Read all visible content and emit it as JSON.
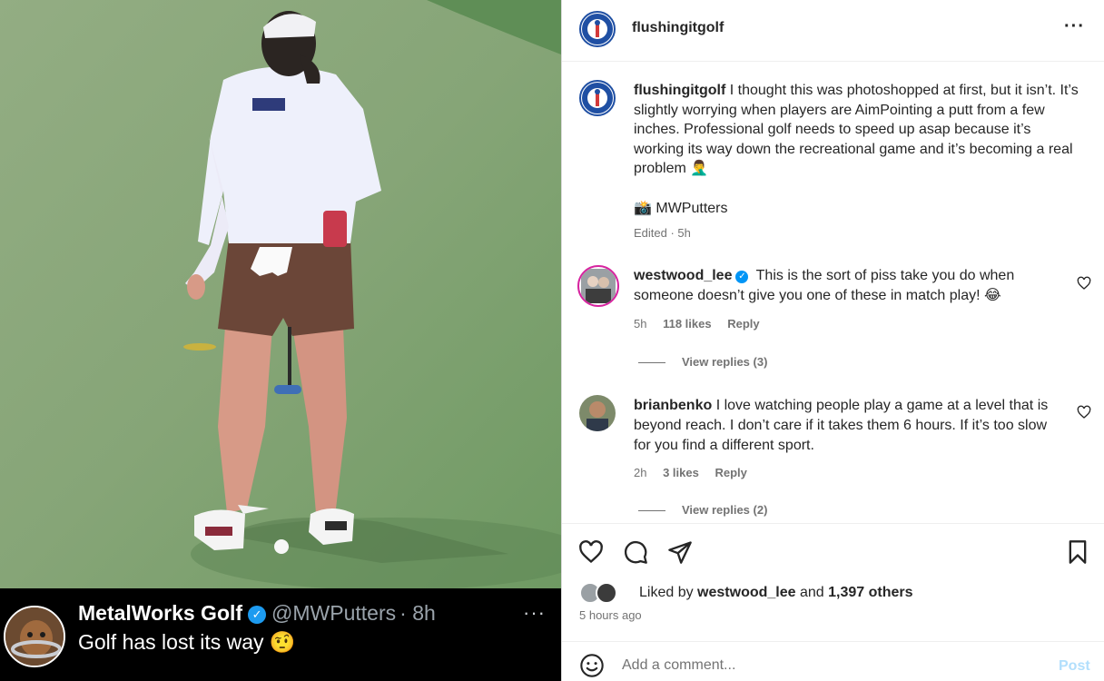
{
  "tweet": {
    "name": "MetalWorks Golf",
    "verified_icon": "verified-check-icon",
    "handle": "@MWPutters",
    "age": "· 8h",
    "more": "···",
    "text": "Golf has lost its way",
    "emoji": "🤨"
  },
  "post": {
    "username": "flushingitgolf",
    "more": "···",
    "caption": "I thought this was photoshopped at first, but it isn’t. It’s slightly worrying when players are AimPointing a putt from a few inches. Professional golf needs to speed up asap because it’s working its way down the recreational game and it’s becoming a real problem",
    "caption_emoji": "🤦‍♂️",
    "credit_icon": "📸",
    "credit": "MWPutters",
    "edited": "Edited · 5h",
    "likes_prefix": "Liked by",
    "likes_user": "westwood_lee",
    "likes_and": "and",
    "likes_others": "1,397 others",
    "time_ago": "5 hours ago"
  },
  "comments": [
    {
      "username": "westwood_lee",
      "verified": true,
      "text": "This is the sort of piss take you do when someone doesn’t give you one of these in match play!",
      "emoji": "😂",
      "age": "5h",
      "likes": "118 likes",
      "reply": "Reply",
      "view_replies": "View replies (3)"
    },
    {
      "username": "brianbenko",
      "verified": false,
      "text": "I love watching people play a game at a level that is beyond reach. I don’t care if it takes them 6 hours. If it’s too slow for you find a different sport.",
      "age": "2h",
      "likes": "3 likes",
      "reply": "Reply",
      "view_replies": "View replies (2)"
    }
  ],
  "add_comment": {
    "placeholder": "Add a comment...",
    "post_label": "Post"
  },
  "colors": {
    "accent_blue": "#0095f6",
    "post_disabled": "#b2dffc",
    "secondary_text": "#737373",
    "green_turf": "#6f9a63"
  }
}
